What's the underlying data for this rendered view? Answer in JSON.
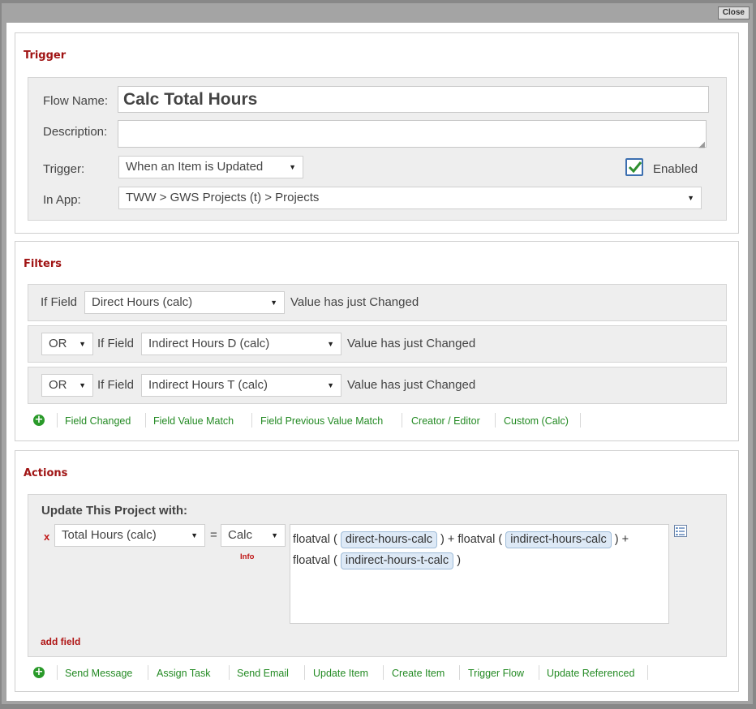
{
  "close_label": "Close",
  "trigger": {
    "title": "Trigger",
    "flow_name_label": "Flow Name:",
    "flow_name_value": "Calc Total Hours",
    "description_label": "Description:",
    "description_value": "",
    "trigger_label": "Trigger:",
    "trigger_value": "When an Item is Updated",
    "enabled_label": "Enabled",
    "enabled": true,
    "in_app_label": "In App:",
    "in_app_value": "TWW > GWS Projects (t) > Projects"
  },
  "filters": {
    "title": "Filters",
    "rows": [
      {
        "connector": "",
        "if_field_label": "If Field",
        "field": "Direct Hours (calc)",
        "condition": "Value has just Changed"
      },
      {
        "connector": "OR",
        "if_field_label": "If Field",
        "field": "Indirect Hours D (calc)",
        "condition": "Value has just Changed"
      },
      {
        "connector": "OR",
        "if_field_label": "If Field",
        "field": "Indirect Hours T (calc)",
        "condition": "Value has just Changed"
      }
    ],
    "links": [
      "Field Changed",
      "Field Value Match",
      "Field Previous Value Match",
      "Creator / Editor",
      "Custom (Calc)"
    ]
  },
  "actions": {
    "title": "Actions",
    "update_title": "Update This Project with:",
    "remove_label": "x",
    "field": "Total Hours (calc)",
    "equals": "=",
    "mode": "Calc",
    "info_label": "Info",
    "formula": {
      "f1": "floatval (",
      "t1": "direct-hours-calc",
      "f2": ") + floatval (",
      "t2": "indirect-hours-calc",
      "f3": ") +",
      "f4": "floatval (",
      "t3": "indirect-hours-t-calc",
      "f5": ")"
    },
    "add_field_label": "add field",
    "links": [
      "Send Message",
      "Assign Task",
      "Send Email",
      "Update Item",
      "Create Item",
      "Trigger Flow",
      "Update Referenced"
    ]
  },
  "colors": {
    "accent_red": "#a01414",
    "link_green": "#238a23",
    "token_blue": "#dde9f6"
  }
}
